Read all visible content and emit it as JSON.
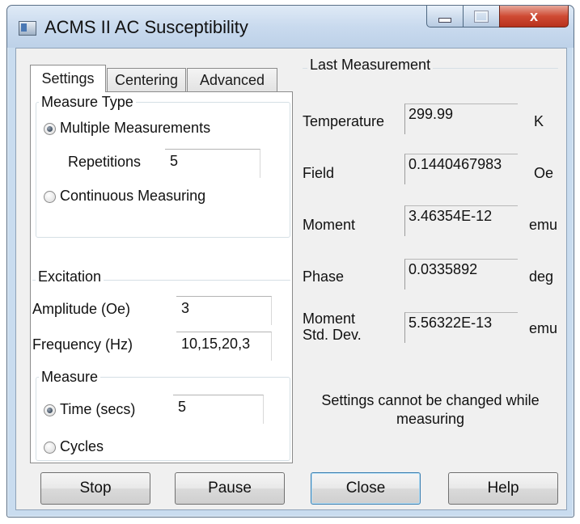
{
  "window": {
    "title": "ACMS II AC Susceptibility",
    "controls": {
      "minimize": "minimize",
      "maximize": "maximize",
      "close": "x"
    }
  },
  "tabs": [
    {
      "label": "Settings",
      "active": true
    },
    {
      "label": "Centering",
      "active": false
    },
    {
      "label": "Advanced",
      "active": false
    }
  ],
  "settings": {
    "measure_type": {
      "title": "Measure Type",
      "options": [
        {
          "label": "Multiple Measurements",
          "checked": true
        },
        {
          "label": "Continuous Measuring",
          "checked": false
        }
      ],
      "repetitions_label": "Repetitions",
      "repetitions_value": "5"
    },
    "excitation": {
      "title": "Excitation",
      "amplitude_label": "Amplitude (Oe)",
      "amplitude_value": "3",
      "frequency_label": "Frequency (Hz)",
      "frequency_value": "10,15,20,3"
    },
    "measure": {
      "title": "Measure",
      "options": [
        {
          "label": "Time (secs)",
          "checked": true
        },
        {
          "label": "Cycles",
          "checked": false
        }
      ],
      "time_value": "5"
    }
  },
  "last_measurement": {
    "title": "Last Measurement",
    "rows": [
      {
        "label": "Temperature",
        "value": "299.99",
        "unit": "K"
      },
      {
        "label": "Field",
        "value": "0.1440467983",
        "unit": "Oe"
      },
      {
        "label": "Moment",
        "value": "3.46354E-12",
        "unit": "emu"
      },
      {
        "label": "Phase",
        "value": "0.0335892",
        "unit": "deg"
      },
      {
        "label": "Moment\nStd. Dev.",
        "value": "5.56322E-13",
        "unit": "emu"
      }
    ],
    "note": "Settings cannot be changed while measuring"
  },
  "buttons": {
    "stop": "Stop",
    "pause": "Pause",
    "close": "Close",
    "help": "Help"
  }
}
